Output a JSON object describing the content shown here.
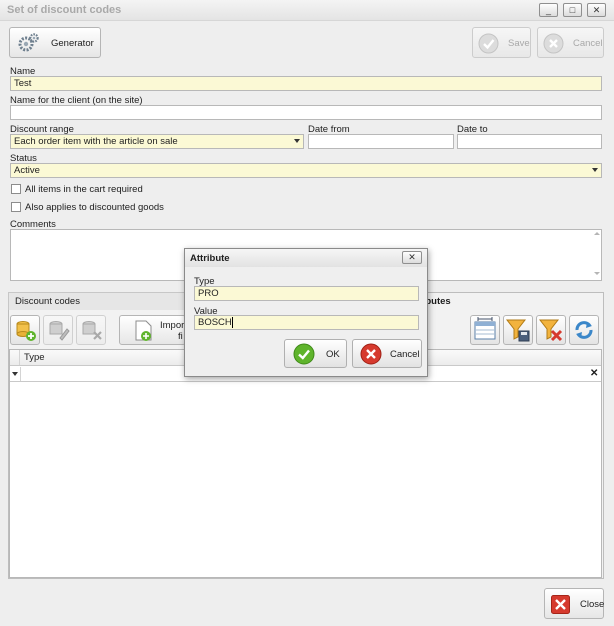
{
  "window": {
    "title": "Set of discount codes",
    "controls": [
      "_",
      "□",
      "✕"
    ]
  },
  "toolbar": {
    "generator_label": "Generator",
    "save_label": "Save",
    "cancel_label": "Cancel"
  },
  "form": {
    "name_label": "Name",
    "name_value": "Test",
    "client_name_label": "Name for the client (on the site)",
    "client_name_value": "",
    "discount_range_label": "Discount range",
    "discount_range_value": "Each order item with the article on sale",
    "date_from_label": "Date from",
    "date_from_value": "",
    "date_to_label": "Date to",
    "date_to_value": "",
    "status_label": "Status",
    "status_value": "Active",
    "all_items_label": "All items in the cart required",
    "all_items_checked": false,
    "discounted_label": "Also applies to discounted goods",
    "discounted_checked": false,
    "comments_label": "Comments",
    "comments_value": ""
  },
  "tabs": [
    {
      "label": "Discount codes",
      "active": false
    },
    {
      "label": "ributes",
      "active": true
    }
  ],
  "tab_toolbar": {
    "import_label_line1": "Import",
    "import_label_line2": "fi"
  },
  "grid": {
    "columns": [
      "Type"
    ],
    "filter_icon": "filter-icon",
    "clear_icon": "✕"
  },
  "dialog": {
    "title": "Attribute",
    "close_glyph": "✕",
    "type_label": "Type",
    "type_value": "PRO",
    "value_label": "Value",
    "value_value": "BOSCH",
    "ok_label": "OK",
    "cancel_label": "Cancel"
  },
  "footer": {
    "close_label": "Close"
  },
  "colors": {
    "required_field": "#fbf9d5",
    "ok_green": "#5fb42c",
    "cancel_red": "#d63a2e"
  }
}
